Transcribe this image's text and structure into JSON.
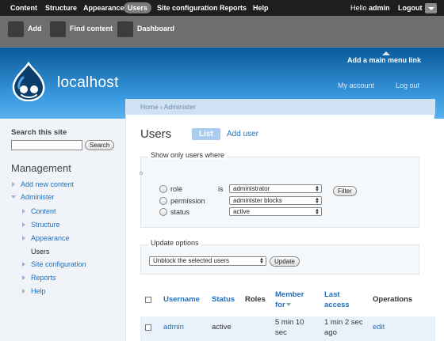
{
  "toolbar": {
    "menu": [
      "Content",
      "Structure",
      "Appearance",
      "Users",
      "Site configuration",
      "Reports",
      "Help"
    ],
    "active_item": "Users",
    "hello_prefix": "Hello ",
    "username": "admin",
    "logout": "Logout",
    "shortcuts": [
      "Add",
      "Find content",
      "Dashboard"
    ]
  },
  "header": {
    "main_menu_link": "Add a main menu link",
    "site_name": "localhost",
    "secondary": [
      "My account",
      "Log out"
    ],
    "logo_icon": "drupal-drop-icon"
  },
  "sidebar": {
    "search_title": "Search this site",
    "search_button": "Search",
    "management_title": "Management",
    "add_new_content": "Add new content",
    "administer": "Administer",
    "sub_items": [
      "Content",
      "Structure",
      "Appearance",
      "Users",
      "Site configuration",
      "Reports",
      "Help"
    ]
  },
  "main": {
    "breadcrumb": "Home › Administer",
    "title": "Users",
    "tabs": [
      "List",
      "Add user"
    ],
    "filter": {
      "legend": "Show only users where",
      "rows": [
        {
          "label": "role",
          "op": "is",
          "value": "administrator"
        },
        {
          "label": "permission",
          "op": "",
          "value": "administer blocks"
        },
        {
          "label": "status",
          "op": "",
          "value": "active"
        }
      ],
      "button": "Filter"
    },
    "update": {
      "legend": "Update options",
      "select": "Unblock the selected users",
      "button": "Update"
    },
    "table": {
      "headers": {
        "username": "Username",
        "status": "Status",
        "roles": "Roles",
        "member_for_1": "Member",
        "member_for_2": "for",
        "last_access_1": "Last",
        "last_access_2": "access",
        "operations": "Operations"
      },
      "rows": [
        {
          "username": "admin",
          "status": "active",
          "roles": "",
          "member_for_1": "5 min 10",
          "member_for_2": "sec",
          "last_access_1": "1 min 2 sec",
          "last_access_2": "ago",
          "operation": "edit"
        }
      ]
    }
  },
  "colors": {
    "toolbar_top": "#1e1e1e",
    "toolbar_shortcuts": "#6e6e6e",
    "header_top": "#0a5a9a",
    "header_bottom": "#5ab0ec",
    "link": "#1f6fbf",
    "sidebar_bg": "#f0f4f8"
  }
}
